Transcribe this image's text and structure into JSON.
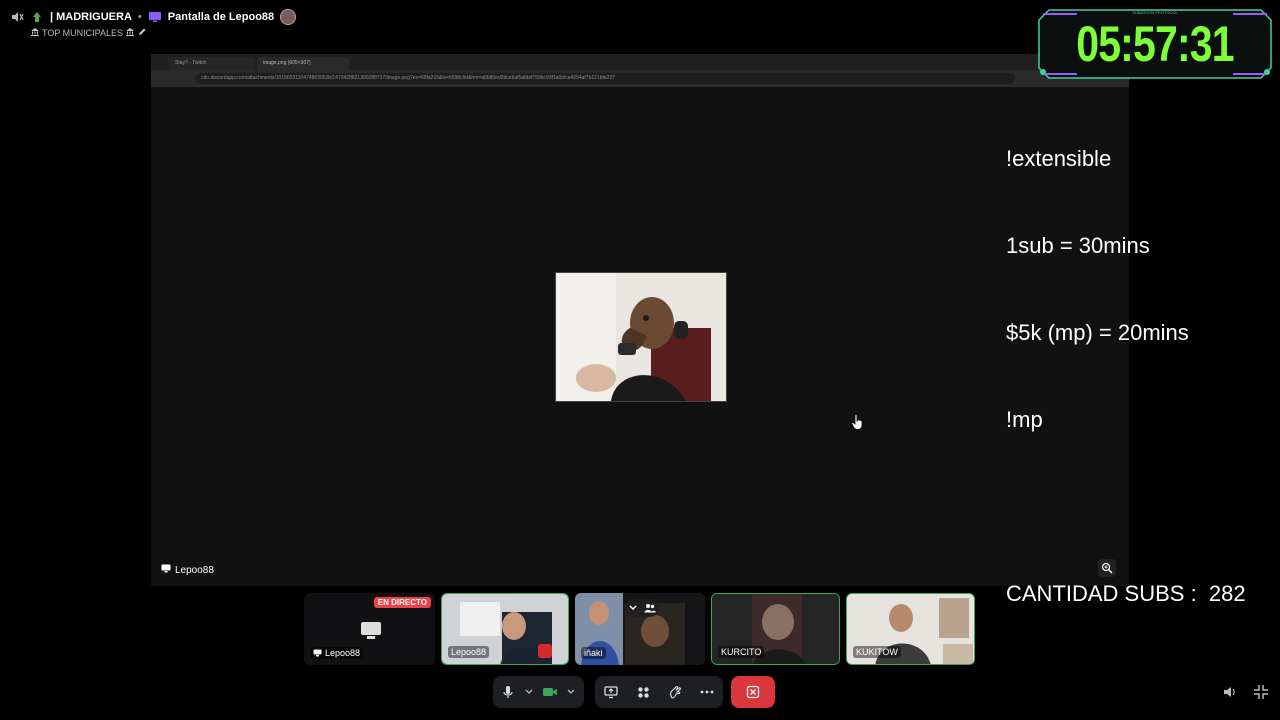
{
  "header": {
    "server_name": "| MADRIGUERA",
    "separator": "•",
    "stream_title": "Pantalla de Lepoo88",
    "channel_label": "TOP MUNICIPALES"
  },
  "browser": {
    "tab1": "Stay? - Twitch",
    "tab2": "image.png (605×307)",
    "address": "cdn.discordapp.com/attachments/1015033110474863052b/1473428621300288737/image.png?ex=69fa215&is=6998c9d&hm=a8b80ed2dce6af5afdaf759bc93f1a0cfce4254af7b121bfe227"
  },
  "stage": {
    "streamer_name": "Lepoo88"
  },
  "overlay": {
    "line1": "!extensible",
    "line2": "1sub = 30mins",
    "line3": "$5k (mp) = 20mins",
    "line4": "!mp",
    "line5": "CANTIDAD SUBS :  282"
  },
  "timer": {
    "value": "05:57:31",
    "small_caption": "SUBATHON PROTOCOL",
    "color": "#7dff3a"
  },
  "participants": [
    {
      "name": "Lepoo88",
      "live_badge": "EN DIRECTO",
      "kind": "screen-share"
    },
    {
      "name": "Lepoo88",
      "kind": "camera"
    },
    {
      "name": "iñaki",
      "kind": "camera"
    },
    {
      "name": "KURCITO",
      "kind": "camera"
    },
    {
      "name": "KUKITOW",
      "kind": "camera"
    }
  ],
  "controls": {
    "end_call_color": "#da373c"
  }
}
